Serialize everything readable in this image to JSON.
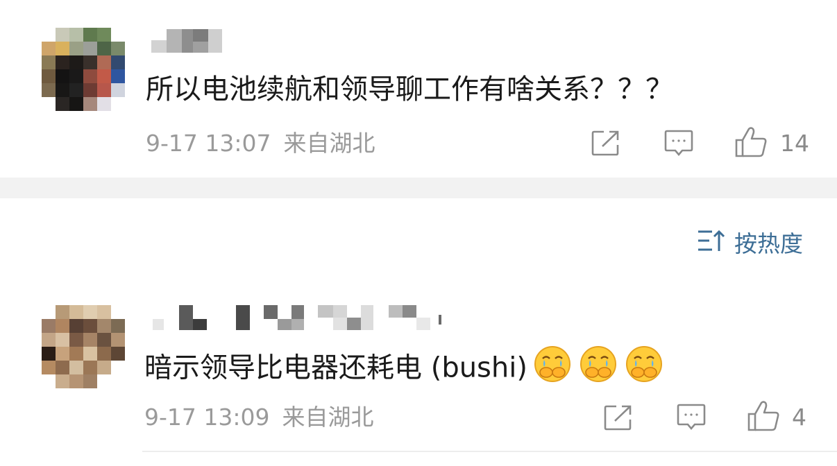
{
  "comments": [
    {
      "text": "所以电池续航和领导聊工作有啥关系？？？",
      "time": "9-17 13:07",
      "location": "来自湖北",
      "likes": "14"
    },
    {
      "text": "暗示领导比电器还耗电 (bushi)",
      "emoji": [
        "crying-covering-mouth-emoji",
        "crying-covering-mouth-emoji",
        "crying-covering-mouth-emoji"
      ],
      "time": "9-17 13:09",
      "location": "来自湖北",
      "likes": "4"
    }
  ],
  "sort": {
    "label": "按热度"
  },
  "icons": [
    "share-icon",
    "comment-icon",
    "like-icon",
    "sort-icon"
  ],
  "colors": {
    "accent": "#3d6e96",
    "meta": "#9a9a9a",
    "separator": "#f2f2f2"
  }
}
